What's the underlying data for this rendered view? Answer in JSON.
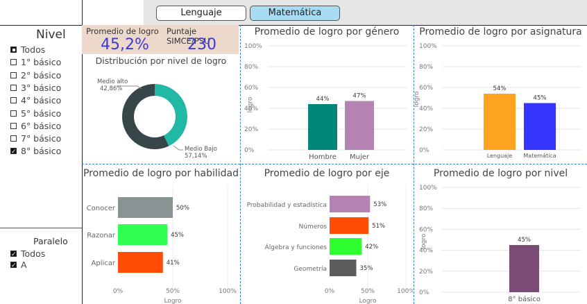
{
  "tabs": [
    {
      "label": "Lenguaje",
      "active": false
    },
    {
      "label": "Matemática",
      "active": true
    }
  ],
  "nivel_slicer": {
    "title": "Nivel",
    "items": [
      {
        "label": "Todos",
        "state": "partial"
      },
      {
        "label": "1° básico",
        "state": "unchecked"
      },
      {
        "label": "2° básico",
        "state": "unchecked"
      },
      {
        "label": "3° básico",
        "state": "unchecked"
      },
      {
        "label": "4° básico",
        "state": "unchecked"
      },
      {
        "label": "5° básico",
        "state": "unchecked"
      },
      {
        "label": "6° básico",
        "state": "unchecked"
      },
      {
        "label": "7° básico",
        "state": "unchecked"
      },
      {
        "label": "8° básico",
        "state": "checked"
      }
    ]
  },
  "paralelo_slicer": {
    "title": "Paralelo",
    "items": [
      {
        "label": "Todos",
        "state": "checked"
      },
      {
        "label": "A",
        "state": "checked"
      }
    ]
  },
  "kpis": {
    "logro_label": "Promedio de logro",
    "logro_value": "45,2%",
    "simce_label": "Puntaje SIMCE/PSU",
    "simce_value": "230"
  },
  "colors": {
    "accent_blue": "#3b3bd8",
    "kpi_bg": "#ecd9cc",
    "divider": "#3b7bd6"
  },
  "chart_data": [
    {
      "id": "donut",
      "type": "pie",
      "title": "Distribución por nivel de logro",
      "categories": [
        "Medio alto",
        "Medio Bajo"
      ],
      "values": [
        42.86,
        57.14
      ],
      "labels": [
        "42,86%",
        "57,14%"
      ],
      "colors": [
        "#1fb9a6",
        "#374649"
      ]
    },
    {
      "id": "genero",
      "type": "bar",
      "title": "Promedio de logro por género",
      "ylabel": "logro",
      "categories": [
        "Hombre",
        "Mujer"
      ],
      "values": [
        44,
        47
      ],
      "labels": [
        "44%",
        "47%"
      ],
      "colors": [
        "#00877a",
        "#b583b2"
      ],
      "yticks": [
        "0%",
        "20%",
        "40%",
        "60%",
        "80%",
        "100%"
      ],
      "ylim": [
        0,
        100
      ]
    },
    {
      "id": "asignatura",
      "type": "bar",
      "title": "Promedio de logro por asignatura",
      "ylabel": "logro",
      "categories": [
        "Lenguaje",
        "Matemática"
      ],
      "values": [
        54,
        45
      ],
      "labels": [
        "54%",
        "45%"
      ],
      "colors": [
        "#ffa41e",
        "#3535ff"
      ],
      "yticks": [
        "0%",
        "20%",
        "40%",
        "60%",
        "80%",
        "100%"
      ],
      "ylim": [
        0,
        100
      ]
    },
    {
      "id": "habilidad",
      "type": "bar",
      "orientation": "horizontal",
      "title": "Promedio de logro por habilidad",
      "xlabel": "Logro",
      "categories": [
        "Conocer",
        "Razonar",
        "Aplicar"
      ],
      "values": [
        50,
        45,
        41
      ],
      "labels": [
        "50%",
        "45%",
        "41%"
      ],
      "colors": [
        "#8a9393",
        "#2eff51",
        "#ff4d07"
      ],
      "xticks": [
        "0%",
        "50%",
        "100%"
      ],
      "xlim": [
        0,
        100
      ]
    },
    {
      "id": "eje",
      "type": "bar",
      "orientation": "horizontal",
      "title": "Promedio de logro por eje",
      "xlabel": "Logro",
      "categories": [
        "Probabilidad y estadística",
        "Números",
        "Álgebra y funciones",
        "Geometría"
      ],
      "values": [
        53,
        51,
        42,
        35
      ],
      "labels": [
        "53%",
        "51%",
        "42%",
        "35%"
      ],
      "colors": [
        "#b583b2",
        "#ff4d07",
        "#2eff2e",
        "#5c5c5c"
      ],
      "xticks": [
        "0%",
        "50%",
        "100%"
      ],
      "xlim": [
        0,
        100
      ]
    },
    {
      "id": "nivel",
      "type": "bar",
      "title": "Promedio de logro por nivel",
      "ylabel": "logro",
      "categories": [
        "8° básico"
      ],
      "values": [
        45
      ],
      "labels": [
        "45%"
      ],
      "colors": [
        "#7a4b73"
      ],
      "yticks": [
        "0%",
        "20%",
        "40%",
        "60%",
        "80%",
        "100%"
      ],
      "ylim": [
        0,
        100
      ]
    }
  ]
}
